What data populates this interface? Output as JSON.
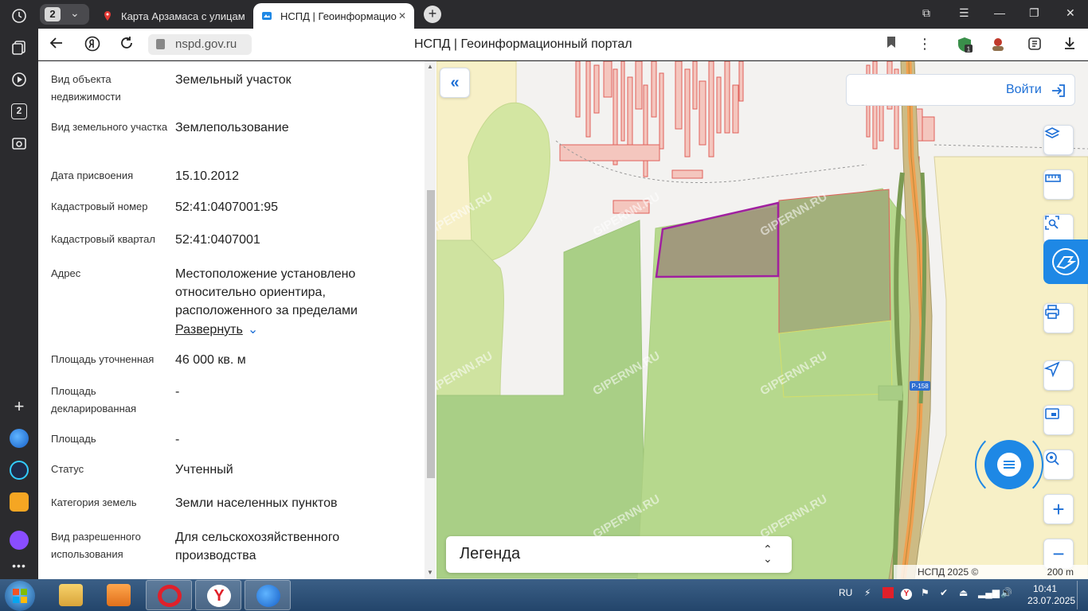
{
  "browser": {
    "tab_count": "2",
    "tabs": [
      {
        "title": "Карта Арзамаса с улицам",
        "active": false
      },
      {
        "title": "НСПД | Геоинформацио",
        "active": true
      }
    ],
    "address": {
      "domain": "nspd.gov.ru"
    },
    "page_title": "НСПД | Геоинформационный портал",
    "side_badge": "2",
    "extension_badge": "1"
  },
  "property": {
    "fields": [
      {
        "label": "Вид объекта недвижимости",
        "value": "Земельный участок"
      },
      {
        "label": "Вид земельного участка",
        "value": "Землепользование"
      },
      {
        "label": "Дата присвоения",
        "value": "15.10.2012"
      },
      {
        "label": "Кадастровый номер",
        "value": "52:41:0407001:95"
      },
      {
        "label": "Кадастровый квартал",
        "value": "52:41:0407001"
      },
      {
        "label": "Адрес",
        "value": "Местоположение установлено относительно ориентира, расположенного за пределами"
      },
      {
        "label": "Площадь уточненная",
        "value": "46 000 кв. м"
      },
      {
        "label": "Площадь декларированная",
        "value": "-"
      },
      {
        "label": "Площадь",
        "value": "-"
      },
      {
        "label": "Статус",
        "value": "Учтенный"
      },
      {
        "label": "Категория земель",
        "value": "Земли населенных пунктов"
      },
      {
        "label": "Вид разрешенного использования",
        "value": "Для сельскохозяйственного производства"
      }
    ],
    "expand_label": "Развернуть"
  },
  "map": {
    "login_label": "Войти",
    "legend_label": "Легенда",
    "attribution": "НСПД 2025 ©",
    "scale_label": "200 m",
    "road_label": "Р-158",
    "watermark": "GIPERNN.RU",
    "colors": {
      "selected_outline": "#a020a0",
      "parcel_outline": "#e0605a",
      "accent": "#1d6fd6"
    }
  },
  "taskbar": {
    "language": "RU",
    "time": "10:41",
    "date": "23.07.2025"
  }
}
